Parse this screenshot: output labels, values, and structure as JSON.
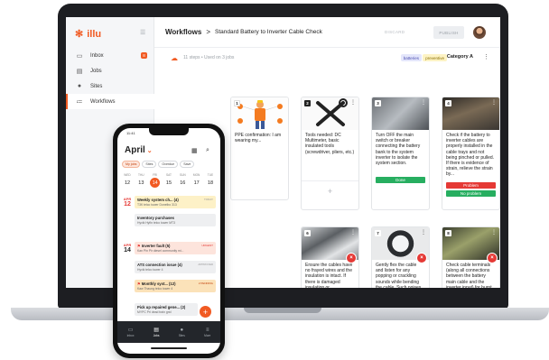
{
  "app": {
    "logo_text": "illu",
    "sidebar": {
      "items": [
        {
          "label": "Inbox",
          "icon": "inbox-icon",
          "badge": "8"
        },
        {
          "label": "Jobs",
          "icon": "clipboard-icon"
        },
        {
          "label": "Sites",
          "icon": "location-pin-icon"
        },
        {
          "label": "Workflows",
          "icon": "workflow-icon",
          "active": true
        }
      ]
    },
    "header": {
      "breadcrumb_root": "Workflows",
      "breadcrumb_sep": ">",
      "breadcrumb_title": "Standard Battery to Inverter Cable Check",
      "discard_label": "DISCARD",
      "publish_label": "PUBLISH"
    },
    "subbar": {
      "steps_text": "11 steps • Used on 3 jobs",
      "tags": [
        "batteries",
        "preventive"
      ],
      "category": "Category A"
    },
    "cards": [
      {
        "num": "1",
        "text": "PPE confirmation: I am wearing my..."
      },
      {
        "num": "2",
        "text": "Tools needed: DC Multimeter, basic insulated tools (screwdriver, pliers, etc.)",
        "plus": "+"
      },
      {
        "num": "3",
        "text": "Turn OFF the main switch or breaker connecting the battery bank to the system inverter to isolate the system section.",
        "done_label": "Done"
      },
      {
        "num": "4",
        "text": "Check if the battery to inverter cables are properly installed in the cable trays and not being pinched or pulled. If there is evidence of strain, relieve the strain by...",
        "problem_label": "Problem",
        "noproblem_label": "No problem"
      },
      {
        "num": "6",
        "text": "Ensure the cables have no frayed wires and the insulation is intact. If there is damaged insulation or exposed/frayed wires, cover with..."
      },
      {
        "num": "7",
        "text": "Gently flex the cable and listen for any popping or crackling sounds while bending the cable. Such noises indicate corrosion and will..."
      },
      {
        "num": "8",
        "text": "Check cable terminals (along all connections between the battery main cable and the inverter input) for burnt marks, hot..."
      }
    ]
  },
  "phone": {
    "status_time": "11:41",
    "month": "April",
    "filters": [
      "My jobs",
      "Sites",
      "Overdue",
      "Save"
    ],
    "week": [
      {
        "n": "WED",
        "d": "12"
      },
      {
        "n": "THU",
        "d": "13"
      },
      {
        "n": "FRI",
        "d": "14",
        "sel": true
      },
      {
        "n": "SAT",
        "d": "15"
      },
      {
        "n": "SUN",
        "d": "16"
      },
      {
        "n": "MON",
        "d": "17"
      },
      {
        "n": "TUE",
        "d": "18"
      }
    ],
    "groups": [
      {
        "mon": "APR",
        "day": "12"
      },
      {
        "mon": "APR",
        "day": "14"
      }
    ],
    "jobs": [
      {
        "title": "Weekly system ch... (4)",
        "sub": "T3K telco tower Donelbo 313",
        "right": "TODAY"
      },
      {
        "title": "Inventory purchases",
        "sub": "Hyvik Hyfin telco tower MT3",
        "right": ""
      },
      {
        "title": "Inverter fault (5)",
        "sub": "Kan Pin Pir diesel community mi...",
        "right": "URGENT"
      },
      {
        "title": "ATS connection issue (4)",
        "sub": "Hyvik telco tower 4",
        "right": "APPROVED"
      },
      {
        "title": "Monthly syst... (12)",
        "sub": "Kaw Thaung telco tower 4",
        "right": "2 PENDING"
      },
      {
        "title": "Pick up repaired gene... (2)",
        "sub": "MYPC Pri dead train grid",
        "right": ""
      }
    ],
    "tabs": [
      {
        "label": "Inbox",
        "icon": "inbox-icon"
      },
      {
        "label": "Jobs",
        "icon": "clipboard-icon",
        "on": true
      },
      {
        "label": "Sites",
        "icon": "location-pin-icon"
      },
      {
        "label": "More",
        "icon": "menu-icon"
      }
    ]
  },
  "colors": {
    "accent": "#f15a22",
    "danger": "#e53935",
    "success": "#27ae60"
  }
}
